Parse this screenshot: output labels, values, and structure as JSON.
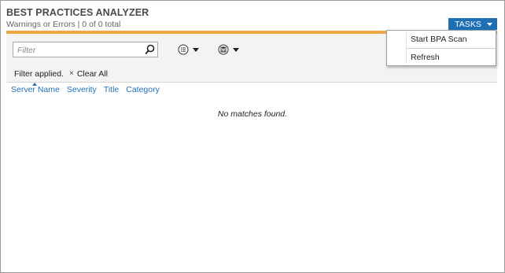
{
  "header": {
    "title": "BEST PRACTICES ANALYZER",
    "subtitle": "Warnings or Errors | 0 of 0 total"
  },
  "tasks": {
    "label": "TASKS",
    "menu": [
      "Start BPA Scan",
      "Refresh"
    ]
  },
  "filter": {
    "placeholder": "Filter",
    "value": "",
    "applied_label": "Filter applied.",
    "clear_label": "Clear All",
    "clear_icon": "×"
  },
  "toolbar": {
    "view_icon": "list-options-icon",
    "save_icon": "save-query-icon"
  },
  "columns": [
    "Server Name",
    "Severity",
    "Title",
    "Category"
  ],
  "results": {
    "empty_message": "No matches found."
  },
  "colors": {
    "accent_blue": "#1f6fb5",
    "orange_bar": "#f0a845",
    "toolbar_bg": "#f3f3f3"
  }
}
